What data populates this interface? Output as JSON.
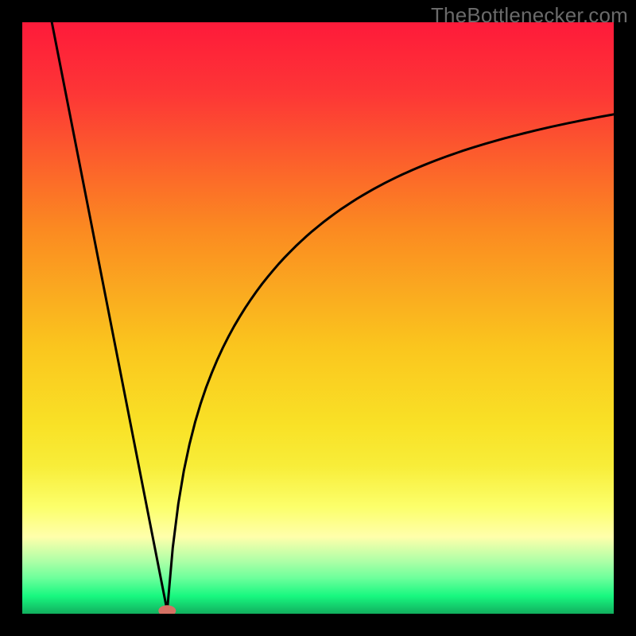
{
  "watermark": "TheBottlenecker.com",
  "chart_data": {
    "type": "line",
    "title": "",
    "xlabel": "",
    "ylabel": "",
    "xlim": [
      0,
      1
    ],
    "ylim": [
      0,
      1
    ],
    "gradient_colors_top_to_bottom": [
      "#fe1a3a",
      "#fd3636",
      "#fb8a21",
      "#fac61e",
      "#f9e126",
      "#f8ed39",
      "#fcff6b",
      "#ffffab",
      "#b0ffa7",
      "#6cff9b",
      "#18f880",
      "#11af5e"
    ],
    "curve_minimum_x": 0.245,
    "marker": {
      "x": 0.245,
      "y": 0.005,
      "color": "#d57164"
    },
    "series": [
      {
        "name": "bottleneck-curve",
        "description": "Black V-shaped curve: steep linear descent from x=0.05 (y=1.0) down to minimum at x=0.245 (y≈0.005), then asymptotic rise toward y≈0.87 at x=1.0",
        "color": "#000000"
      }
    ]
  }
}
